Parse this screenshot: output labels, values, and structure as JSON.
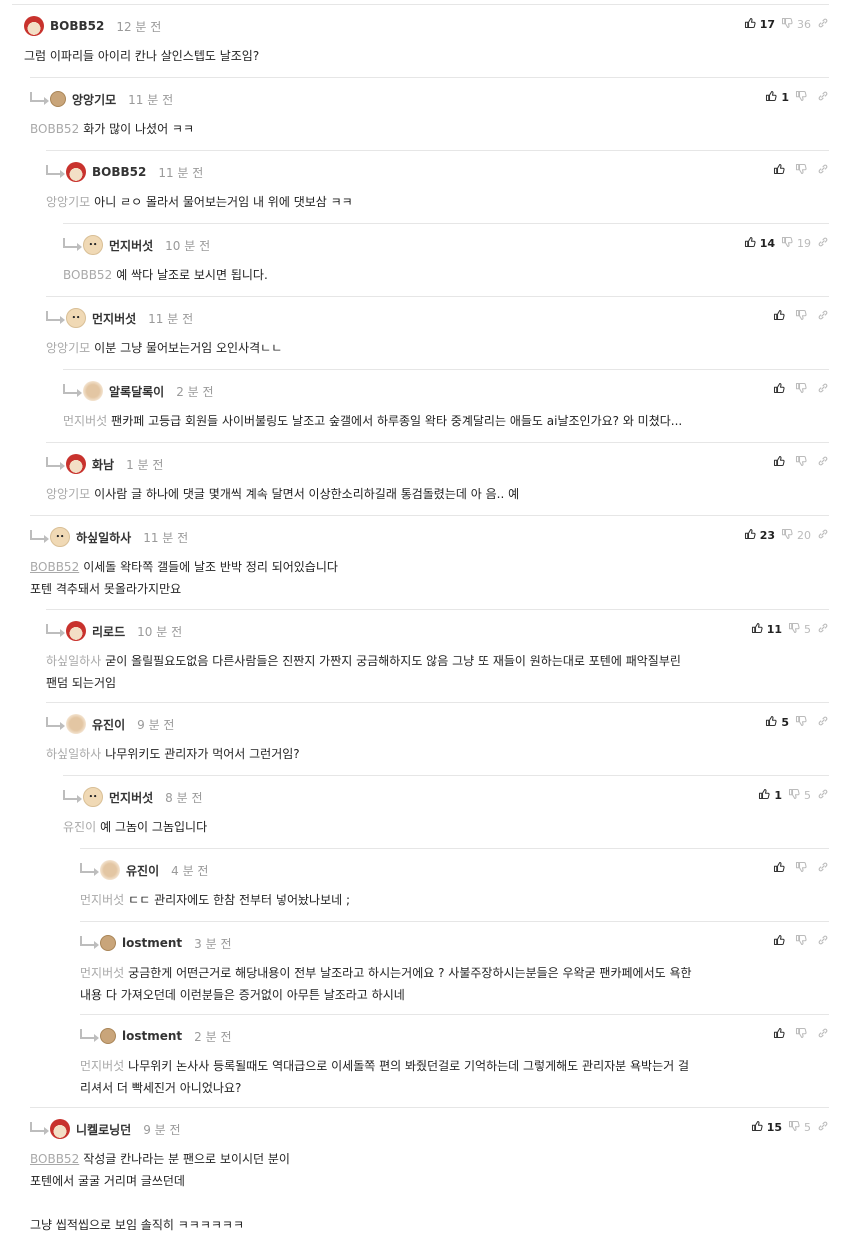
{
  "vote": {
    "up_icon": "thumbs-up-icon",
    "down_icon": "thumbs-down-icon",
    "link_icon": "link-icon"
  },
  "comments": [
    {
      "nick": "BOBB52",
      "time": "12 분 전",
      "up": "17",
      "down": "36",
      "mention": "",
      "text": "그럼 이파리들 아이리 칸나 살인스텝도 날조임?"
    },
    {
      "nick": "앙앙기모",
      "time": "11 분 전",
      "up": "1",
      "down": "",
      "mention": "BOBB52",
      "text": "화가 많이 나셨어 ㅋㅋ"
    },
    {
      "nick": "BOBB52",
      "time": "11 분 전",
      "up": "",
      "down": "",
      "mention": "앙앙기모",
      "text": "아니 ㄹㅇ 몰라서 물어보는거임 내 위에 댓보삼 ㅋㅋ"
    },
    {
      "nick": "먼지버섯",
      "time": "10 분 전",
      "up": "14",
      "down": "19",
      "mention": "BOBB52",
      "text": "예 싹다 날조로 보시면 됩니다."
    },
    {
      "nick": "먼지버섯",
      "time": "11 분 전",
      "up": "",
      "down": "",
      "mention": "앙앙기모",
      "text": "이분 그냥 물어보는거임 오인사격ㄴㄴ"
    },
    {
      "nick": "알록달록이",
      "time": "2 분 전",
      "up": "",
      "down": "",
      "mention": "먼지버섯",
      "text": "팬카페 고등급 회원들 사이버불링도 날조고 숲갤에서 하루종일 왁타 중계달리는 애들도 ai날조인가요? 와 미쳤다..."
    },
    {
      "nick": "화남",
      "time": "1 분 전",
      "up": "",
      "down": "",
      "mention": "앙앙기모",
      "text": "이사람 글 하나에 댓글 몇개씩 계속 달면서 이상한소리하길래 통검돌렸는데 아 음.. 예"
    },
    {
      "nick": "하싶일하사",
      "time": "11 분 전",
      "up": "23",
      "down": "20",
      "mention": "BOBB52",
      "text": "이세돌 왁타쪽 갤들에 날조 반박 정리 되어있습니다\n포텐 격추돼서 못올라가지만요"
    },
    {
      "nick": "리로드",
      "time": "10 분 전",
      "up": "11",
      "down": "5",
      "mention": "하싶일하사",
      "text": "굳이 올릴필요도없음 다른사람들은 진짠지 가짠지 궁금해하지도 않음 그냥 또 재들이 원하는대로 포텐에 패악질부린\n팬덤 되는거임"
    },
    {
      "nick": "유진이",
      "time": "9 분 전",
      "up": "5",
      "down": "",
      "mention": "하싶일하사",
      "text": "나무위키도 관리자가 먹어서 그런거임?"
    },
    {
      "nick": "먼지버섯",
      "time": "8 분 전",
      "up": "1",
      "down": "5",
      "mention": "유진이",
      "text": "예 그놈이 그놈입니다"
    },
    {
      "nick": "유진이",
      "time": "4 분 전",
      "up": "",
      "down": "",
      "mention": "먼지버섯",
      "text": "ㄷㄷ 관리자에도 한참 전부터 넣어놨나보네 ;"
    },
    {
      "nick": "lostment",
      "time": "3 분 전",
      "up": "",
      "down": "",
      "mention": "먼지버섯",
      "text": "궁금한게 어떤근거로 해당내용이 전부 날조라고 하시는거에요 ? 사불주장하시는분들은 우왁굳 팬카페에서도 욕한\n내용 다 가져오던데 이런분들은 증거없이 아무튼 날조라고 하시네"
    },
    {
      "nick": "lostment",
      "time": "2 분 전",
      "up": "",
      "down": "",
      "mention": "먼지버섯",
      "text": "나무위키 논사사 등록될때도 역대급으로 이세돌쪽 편의 봐줬던걸로 기억하는데 그렇게해도 관리자분 욕박는거 걸\n리셔서 더 빡세진거 아니었나요?"
    },
    {
      "nick": "니켈로닝던",
      "time": "9 분 전",
      "up": "15",
      "down": "5",
      "mention": "BOBB52",
      "text": "작성글 칸나라는 분 팬으로 보이시던 분이\n포텐에서 굴굴 거리며 글쓰던데\n\n그냥 씹적씹으로 보임 솔직히 ㅋㅋㅋㅋㅋㅋ"
    }
  ]
}
